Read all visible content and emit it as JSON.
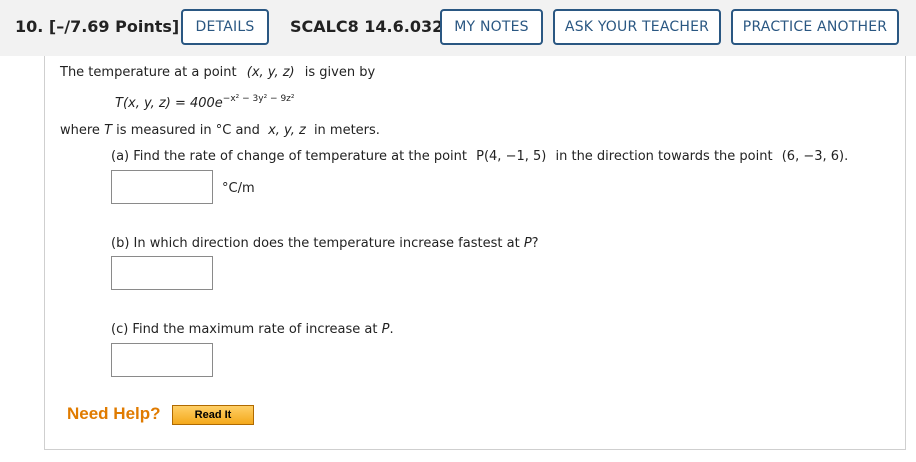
{
  "header": {
    "question_number": "10.",
    "points": "[–/7.69 Points]",
    "details_label": "DETAILS",
    "problem_code": "SCALC8 14.6.032.",
    "my_notes_label": "MY NOTES",
    "ask_teacher_label": "ASK YOUR TEACHER",
    "practice_label": "PRACTICE ANOTHER"
  },
  "question": {
    "intro_text": "The temperature at a point",
    "intro_point": "(x, y, z)",
    "intro_tail": "is given by",
    "formula_lhs": "T(x, y, z) = 400e",
    "formula_exponent": "−x² − 3y² − 9z²",
    "where_prefix": "where",
    "where_T": "T",
    "where_mid": "is measured in °C and",
    "where_vars": "x, y, z",
    "where_tail": "in meters.",
    "part_a_prefix": "(a) Find the rate of change of temperature at the point",
    "part_a_point": "P(4, −1, 5)",
    "part_a_mid": "in the direction towards the point",
    "part_a_target": "(6, −3, 6).",
    "part_a_unit": "°C/m",
    "part_b_text": "(b) In which direction does the temperature increase fastest at",
    "part_b_P": "P",
    "part_b_q": "?",
    "part_c_text": "(c) Find the maximum rate of increase at",
    "part_c_P": "P",
    "part_c_dot": "."
  },
  "help": {
    "need_help_label": "Need Help?",
    "read_it_label": "Read It"
  }
}
